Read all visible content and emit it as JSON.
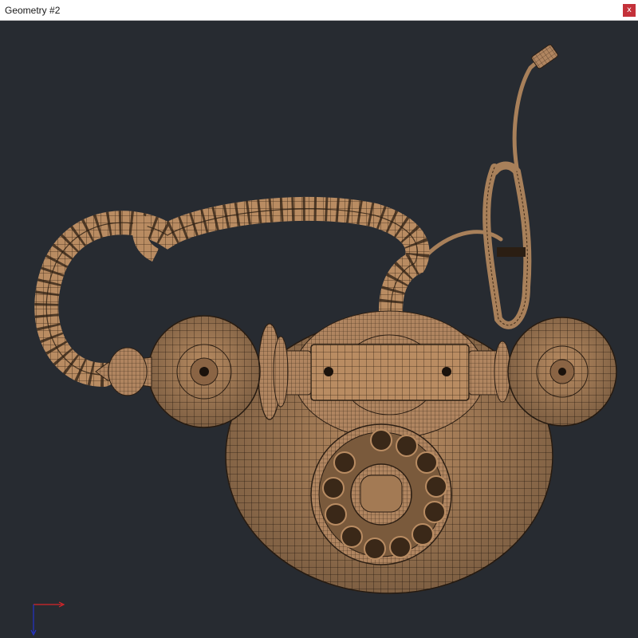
{
  "window": {
    "title": "Geometry #2",
    "close_label": "x"
  },
  "viewport": {
    "background": "#272b31",
    "object": "rotary-telephone-wireframe",
    "material_color": "#b98c62",
    "wire_color": "#2b1e13"
  },
  "axes_gizmo": {
    "x_color": "#d9252a",
    "y_color": "#2434c8"
  }
}
